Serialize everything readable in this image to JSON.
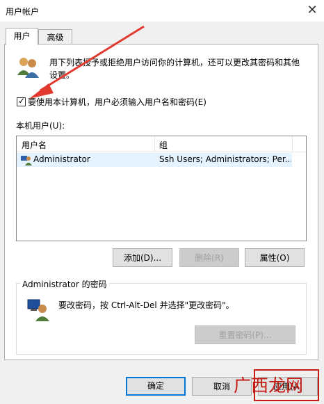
{
  "window": {
    "title": "用户帐户",
    "close_glyph": "✕"
  },
  "tabs": [
    {
      "label": "用户"
    },
    {
      "label": "高级"
    }
  ],
  "intro_text_line1": "用下列表授予或拒绝用户访问你的计算机，还可以更改其密码和其他",
  "intro_text_line2": "设置。",
  "require_login_checkbox": {
    "label": "要使用本计算机，用户必须输入用户名和密码(E)",
    "checked": true,
    "check_glyph": "✓"
  },
  "users_label": "本机用户(U):",
  "users_table": {
    "columns": [
      "用户名",
      "组"
    ],
    "rows": [
      {
        "username": "Administrator",
        "groups": "Ssh Users; Administrators; Per..."
      }
    ]
  },
  "buttons": {
    "add": "添加(D)...",
    "remove": "删除(R)",
    "properties": "属性(O)",
    "reset_password": "重置密码(P)...",
    "ok": "确定",
    "cancel": "取消",
    "apply": "应用(A)"
  },
  "password_group": {
    "title": "Administrator 的密码",
    "text": "要改密码，按 Ctrl-Alt-Del 并选择\"更改密码\"。"
  },
  "watermark": "广西龙网",
  "colors": {
    "annotation_red": "#e23a2e",
    "watermark_red": "#c41a14",
    "focus_blue": "#0078d7",
    "selected_row": "#e5f3ff"
  }
}
